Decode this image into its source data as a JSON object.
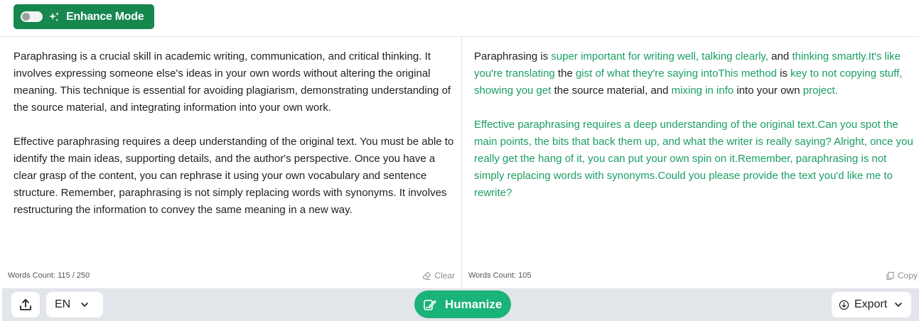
{
  "header": {
    "enhance_label": "Enhance Mode",
    "enhance_enabled": false
  },
  "input": {
    "paragraphs": [
      "Paraphrasing is a crucial skill in academic writing, communication, and critical thinking. It involves expressing someone else's ideas in your own words without altering the original meaning. This technique is essential for avoiding plagiarism, demonstrating understanding of the source material, and integrating information into your own work.",
      "Effective paraphrasing requires a deep understanding of the original text. You must be able to identify the main ideas, supporting details, and the author's perspective. Once you have a clear grasp of the content, you can rephrase it using your own vocabulary and sentence structure. Remember, paraphrasing is not simply replacing words with synonyms. It involves restructuring the information to convey the same meaning in a new way."
    ],
    "word_count": "Words Count: 115 / 250",
    "clear_label": "Clear"
  },
  "output": {
    "paragraphs": [
      [
        {
          "t": "Paraphrasing is ",
          "hl": false
        },
        {
          "t": "super important for writing well, talking clearly,",
          "hl": true
        },
        {
          "t": " and ",
          "hl": false
        },
        {
          "t": "thinking smartly.It's like you're translating",
          "hl": true
        },
        {
          "t": " the ",
          "hl": false
        },
        {
          "t": "gist of what they're saying intoThis method",
          "hl": true
        },
        {
          "t": " is ",
          "hl": false
        },
        {
          "t": "key to not copying stuff, showing you get",
          "hl": true
        },
        {
          "t": " the source material, and ",
          "hl": false
        },
        {
          "t": "mixing in info",
          "hl": true
        },
        {
          "t": " into your own ",
          "hl": false
        },
        {
          "t": "project.",
          "hl": true
        }
      ],
      [
        {
          "t": "Effective paraphrasing requires a deep understanding of the original text.Can you spot the main points, the bits that back them up, and what the writer is really saying? Alright, once you really get the hang of it, you can put your own spin on it.Remember, paraphrasing is not simply replacing words with synonyms.Could you please provide the text you'd like me to rewrite?",
          "hl": true
        }
      ]
    ],
    "word_count": "Words Count: 105",
    "copy_label": "Copy"
  },
  "footer": {
    "language": "EN",
    "humanize_label": "Humanize",
    "export_label": "Export"
  },
  "colors": {
    "enhance_bg": "#17874f",
    "humanize_bg": "#1ab37a",
    "highlight_text": "#1a9e62",
    "bottom_bar": "#e2e5ea"
  },
  "icons": {
    "enhance": [
      "toggle-switch-icon",
      "sparkle-icon"
    ],
    "input": [
      "eraser-icon"
    ],
    "output": [
      "copy-icon"
    ],
    "footer": [
      "upload-icon",
      "chevron-down-icon",
      "humanize-pen-icon",
      "download-icon"
    ]
  }
}
